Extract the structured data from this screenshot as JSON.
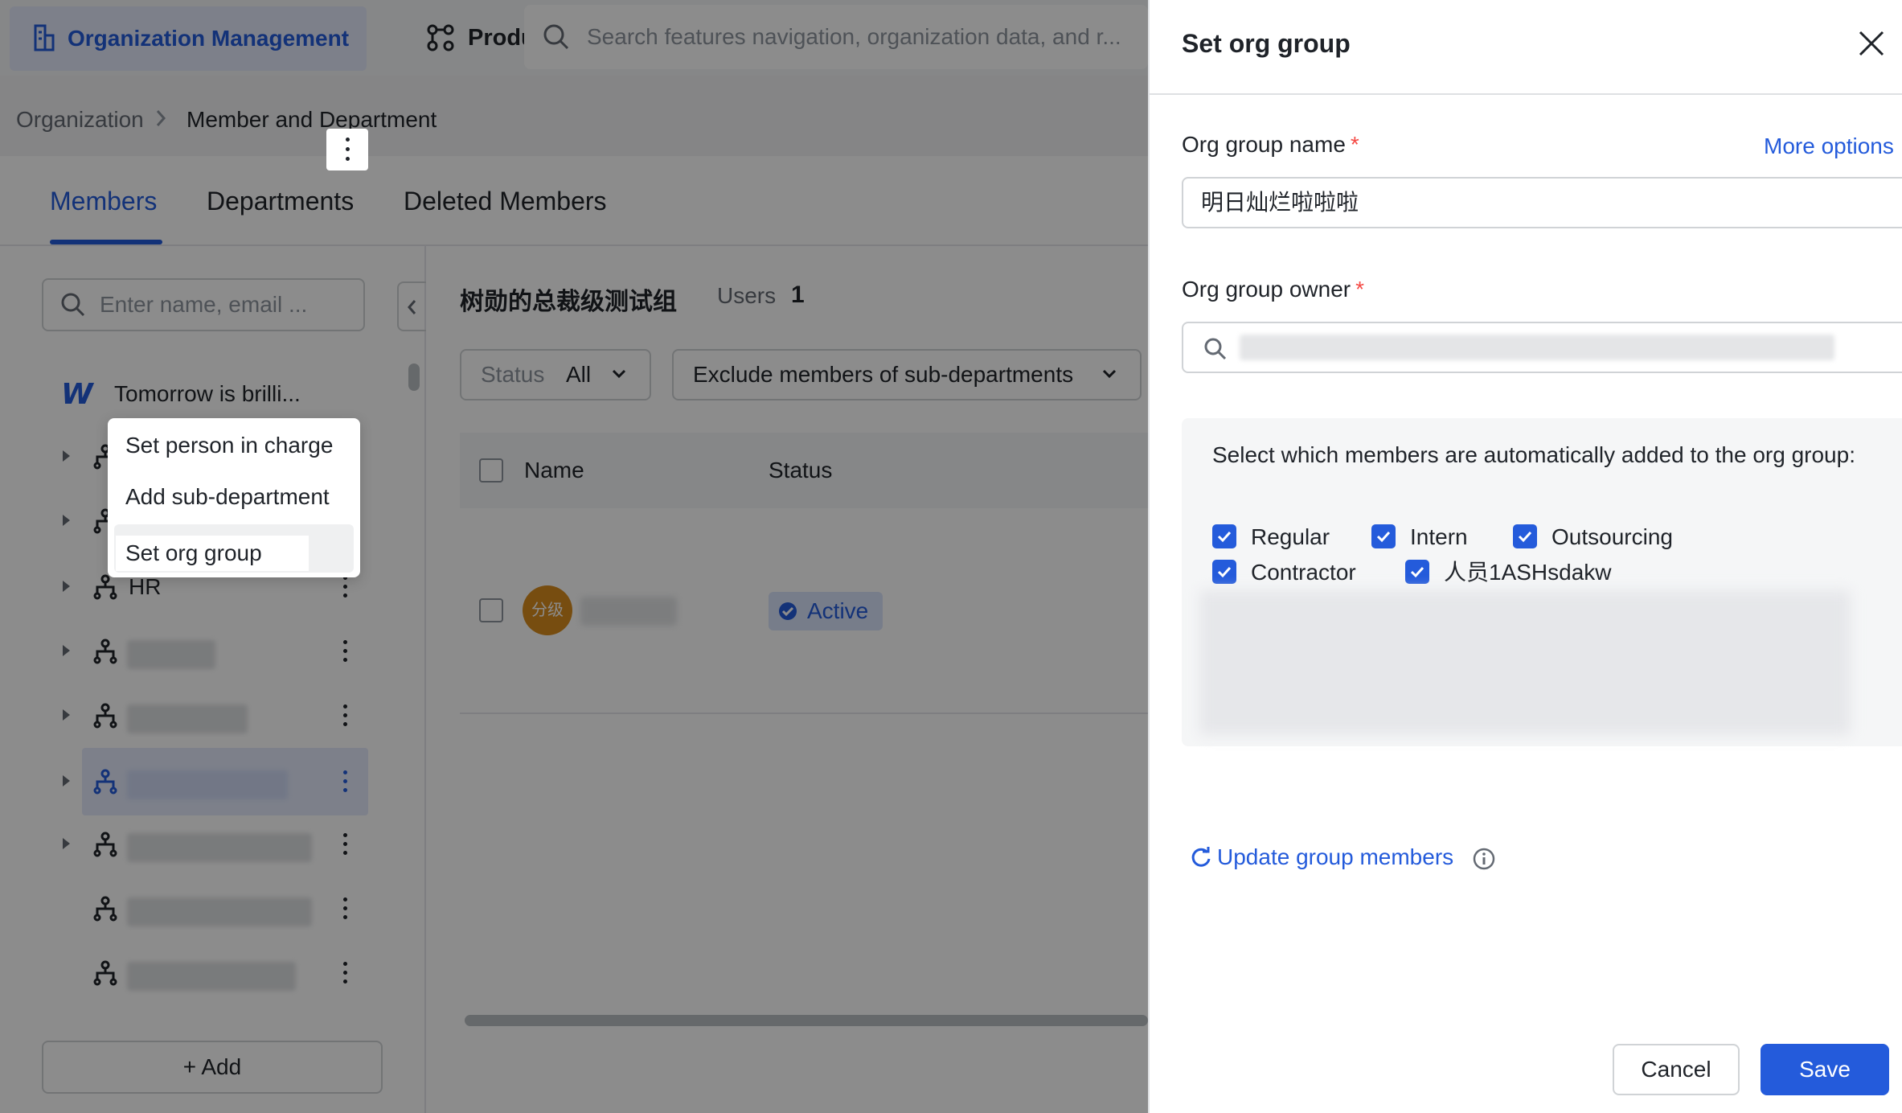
{
  "topbar": {
    "org_tab_label": "Organization Management",
    "product_tab_label": "Produ",
    "search_placeholder": "Search features navigation, organization data, and r..."
  },
  "breadcrumb": {
    "root": "Organization",
    "current": "Member and Department"
  },
  "tabs": [
    "Members",
    "Departments",
    "Deleted Members"
  ],
  "left": {
    "search_placeholder": "Enter name, email ...",
    "root_name": "Tomorrow is brilli...",
    "context_menu": [
      "Set person in charge",
      "Add sub-department",
      "Set org group"
    ],
    "dept_hr": "HR",
    "add_label": "+ Add"
  },
  "main": {
    "group_title": "树勋的总裁级测试组",
    "users_label": "Users",
    "users_count": "1",
    "filter_status_key": "Status",
    "filter_status_value": "All",
    "filter_sub": "Exclude members of sub-departments",
    "col_name": "Name",
    "col_status": "Status",
    "row_avatar_text": "分级",
    "row_status": "Active"
  },
  "drawer": {
    "title": "Set org group",
    "name_label": "Org group name",
    "more_options": "More options",
    "name_value": "明日灿烂啦啦啦",
    "owner_label": "Org group owner",
    "required_mark": "*",
    "members_question": "Select which members are automatically added to the org group:",
    "member_types": [
      "Regular",
      "Intern",
      "Outsourcing",
      "Contractor",
      "人员1ASHsdakw"
    ],
    "update_link": "Update group members",
    "cancel": "Cancel",
    "save": "Save"
  },
  "colors": {
    "accent": "#245bdb",
    "required": "#f54a45",
    "overlay": "rgba(0,0,0,0.45)"
  }
}
